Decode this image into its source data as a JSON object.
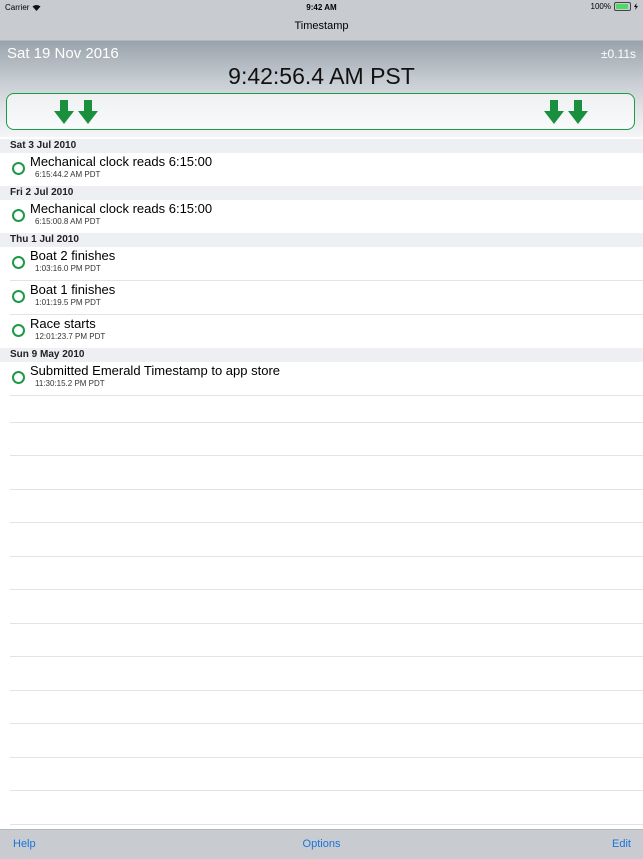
{
  "status_bar": {
    "carrier": "Carrier",
    "time": "9:42 AM",
    "battery": "100%",
    "battery_color": "#4cd964"
  },
  "nav": {
    "title": "Timestamp"
  },
  "clock": {
    "date": "Sat 19 Nov 2016",
    "accuracy": "±0.11s",
    "time": "9:42:56.4 AM PST"
  },
  "stamp_button": {
    "icon": "down-arrow-icon",
    "accent_color": "#1e9a46"
  },
  "sections": [
    {
      "header": "Sat 3 Jul 2010",
      "items": [
        {
          "label": "Mechanical clock reads 6:15:00",
          "time": "6:15:44.2 AM PDT"
        }
      ]
    },
    {
      "header": "Fri 2 Jul 2010",
      "items": [
        {
          "label": "Mechanical clock reads 6:15:00",
          "time": "6:15:00.8 AM PDT"
        }
      ]
    },
    {
      "header": "Thu 1 Jul 2010",
      "items": [
        {
          "label": "Boat 2 finishes",
          "time": "1:03:16.0 PM PDT"
        },
        {
          "label": "Boat 1 finishes",
          "time": "1:01:19.5 PM PDT"
        },
        {
          "label": "Race starts",
          "time": "12:01:23.7 PM PDT"
        }
      ]
    },
    {
      "header": "Sun 9 May 2010",
      "items": [
        {
          "label": "Submitted Emerald Timestamp to app store",
          "time": "11:30:15.2 PM PDT"
        }
      ]
    }
  ],
  "toolbar": {
    "help": "Help",
    "options": "Options",
    "edit": "Edit",
    "link_color": "#1a73d9"
  }
}
